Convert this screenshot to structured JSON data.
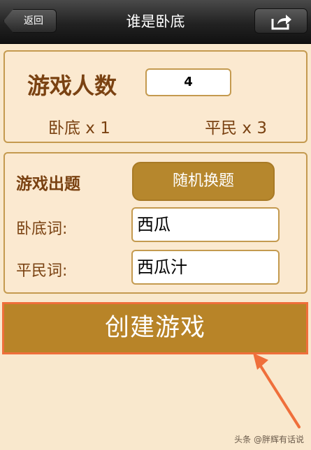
{
  "header": {
    "back_label": "返回",
    "title": "谁是卧底",
    "share_icon": "share-icon"
  },
  "players": {
    "label": "游戏人数",
    "count": "4",
    "spy_count_text": "卧底 x 1",
    "civilian_count_text": "平民 x 3"
  },
  "question": {
    "label": "游戏出题",
    "random_button_label": "随机换题",
    "spy_word_label": "卧底词:",
    "spy_word_value": "西瓜",
    "civilian_word_label": "平民词:",
    "civilian_word_value": "西瓜汁"
  },
  "create_button_label": "创建游戏",
  "watermark": "头条 @胖辉有话说",
  "colors": {
    "background": "#f9e8cd",
    "brown_text": "#7a4212",
    "button_gold": "#b6872d",
    "highlight_orange": "#ef6f3b"
  }
}
